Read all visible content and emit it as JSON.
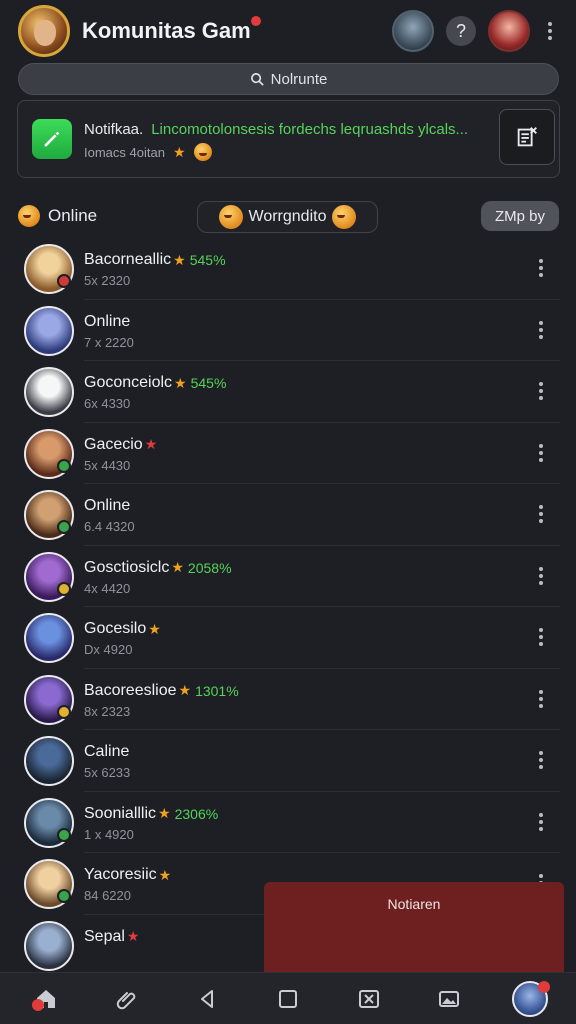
{
  "header": {
    "title": "Komunitas Gam",
    "help_label": "?",
    "icons": {
      "avatar": "game-character-avatar",
      "help": "help-icon",
      "more": "kebab-menu-icon"
    }
  },
  "search": {
    "label": "Nolrunte",
    "icon": "search-icon"
  },
  "notification": {
    "title": "Notifkaa.",
    "message": "Lincomotolonsesis fordechs leqruashds ylcals...",
    "subtitle": "Iomacs 4oitan",
    "icon": "edit-pencil-icon",
    "action_icon": "document-list-icon"
  },
  "filters": {
    "online_label": "Online",
    "middle_label": "Worrgndito",
    "right_label": "ZMp by"
  },
  "friends": [
    {
      "name": "Bacorneallic",
      "pct": "545%",
      "meta": "5x 2320",
      "star": true,
      "av": [
        "#f1d29b",
        "#8a5a2a"
      ],
      "badge": "#d23a3a"
    },
    {
      "name": "Online",
      "pct": "",
      "meta": "7 x 2220",
      "star": false,
      "av": [
        "#9aa8e6",
        "#2c3a7a"
      ],
      "badge": ""
    },
    {
      "name": "Goconceiolc",
      "pct": "545%",
      "meta": "6x 4330",
      "star": true,
      "av": [
        "#f6f6f6",
        "#3a3c45"
      ],
      "badge": ""
    },
    {
      "name": "Gacecio",
      "pct": "",
      "meta": "5x 4430",
      "star": "red",
      "av": [
        "#d89a6a",
        "#5a2a1a"
      ],
      "badge": "#3aa44a"
    },
    {
      "name": "Online",
      "pct": "",
      "meta": "6.4 4320",
      "star": false,
      "av": [
        "#d0a070",
        "#4a2a18"
      ],
      "badge": "#3aa44a"
    },
    {
      "name": "Gosctiosiclc",
      "pct": "2058%",
      "meta": "4x 4420",
      "star": true,
      "av": [
        "#a06ad0",
        "#3a1a5a"
      ],
      "badge": "#e0b030"
    },
    {
      "name": "Gocesilo",
      "pct": "",
      "meta": "Dx 4920",
      "star": true,
      "av": [
        "#6a90e0",
        "#2a2a6a"
      ],
      "badge": ""
    },
    {
      "name": "Bacoreeslioe",
      "pct": "1301%",
      "meta": "8x 2323",
      "star": true,
      "av": [
        "#8a6ad0",
        "#2a1a4a"
      ],
      "badge": "#e0b030"
    },
    {
      "name": "Caline",
      "pct": "",
      "meta": "5x 6233",
      "star": false,
      "av": [
        "#4a6a9a",
        "#1a2430"
      ],
      "badge": ""
    },
    {
      "name": "Soonialllic",
      "pct": "2306%",
      "meta": "1 x 4920",
      "star": true,
      "av": [
        "#6a8aaa",
        "#1a2a3a"
      ],
      "badge": "#3aa44a"
    },
    {
      "name": "Yacoresiic",
      "pct": "",
      "meta": "84 6220",
      "star": true,
      "av": [
        "#f0d0a0",
        "#6a4a2a"
      ],
      "badge": "#3aa44a"
    },
    {
      "name": "Sepal",
      "pct": "",
      "meta": "",
      "star": "red",
      "av": [
        "#9ab0d0",
        "#2a3040"
      ],
      "badge": ""
    }
  ],
  "toast": {
    "label": "Notiaren"
  },
  "bottom_nav": [
    {
      "name": "home",
      "icon": "home-icon"
    },
    {
      "name": "attach",
      "icon": "paperclip-icon"
    },
    {
      "name": "back",
      "icon": "back-triangle-icon"
    },
    {
      "name": "recent",
      "icon": "square-icon"
    },
    {
      "name": "close",
      "icon": "close-box-icon"
    },
    {
      "name": "gallery",
      "icon": "image-icon"
    },
    {
      "name": "profile",
      "icon": "profile-avatar-icon"
    }
  ]
}
